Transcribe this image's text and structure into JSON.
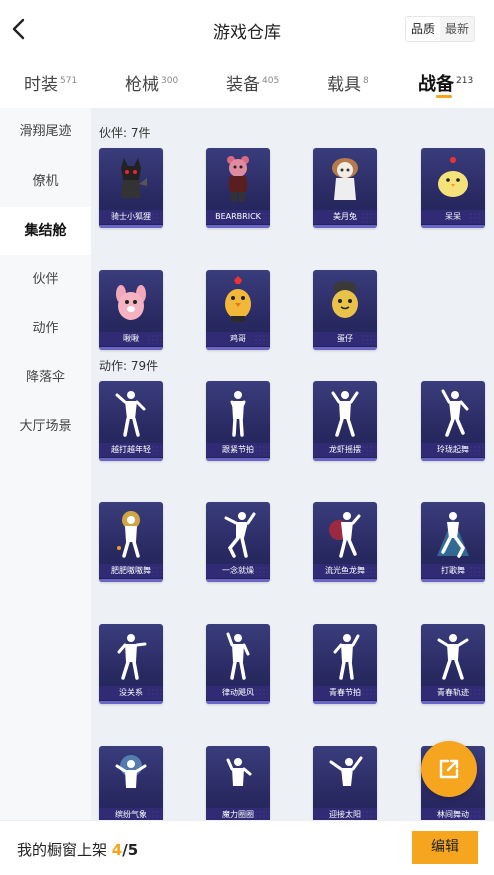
{
  "header": {
    "title": "游戏仓库",
    "sort_options": [
      "品质",
      "最新"
    ],
    "sort_selected": "品质"
  },
  "tabs": [
    {
      "label": "时装",
      "count": "571"
    },
    {
      "label": "枪械",
      "count": "300"
    },
    {
      "label": "装备",
      "count": "405"
    },
    {
      "label": "载具",
      "count": "8"
    },
    {
      "label": "战备",
      "count": "213",
      "active": true
    }
  ],
  "sidebar": {
    "items": [
      {
        "label": "滑翔尾迹"
      },
      {
        "label": "僚机"
      },
      {
        "label": "集结舱",
        "active": true
      },
      {
        "label": "伙伴"
      },
      {
        "label": "动作"
      },
      {
        "label": "降落伞"
      },
      {
        "label": "大厅场景"
      }
    ]
  },
  "sections": {
    "companions": {
      "title": "伙伴: 7件",
      "items": [
        "骑士小狐狸",
        "BEARBRICK",
        "美月兔",
        "呆呆",
        "啾啾",
        "鸡哥",
        "蛋仔"
      ]
    },
    "actions": {
      "title": "动作: 79件",
      "items": [
        "越打越年轻",
        "跟紧节拍",
        "龙虾摇摆",
        "玲珑起舞",
        "肥肥嗷嗷舞",
        "一念就燥",
        "流光鱼龙舞",
        "打歌舞",
        "没关系",
        "律动飓风",
        "青春节拍",
        "青春轨迹",
        "缤纷气象",
        "魔力圈圈",
        "迎接太阳",
        "林间舞动"
      ]
    }
  },
  "bottom": {
    "shelf_label": "我的橱窗上架",
    "shelf_count": "4",
    "shelf_separator": "/",
    "shelf_total": "5",
    "edit_label": "编辑"
  },
  "colors": {
    "accent": "#f5a61e",
    "card_bg": "#2a2a63",
    "content_bg": "#edf0f4"
  }
}
